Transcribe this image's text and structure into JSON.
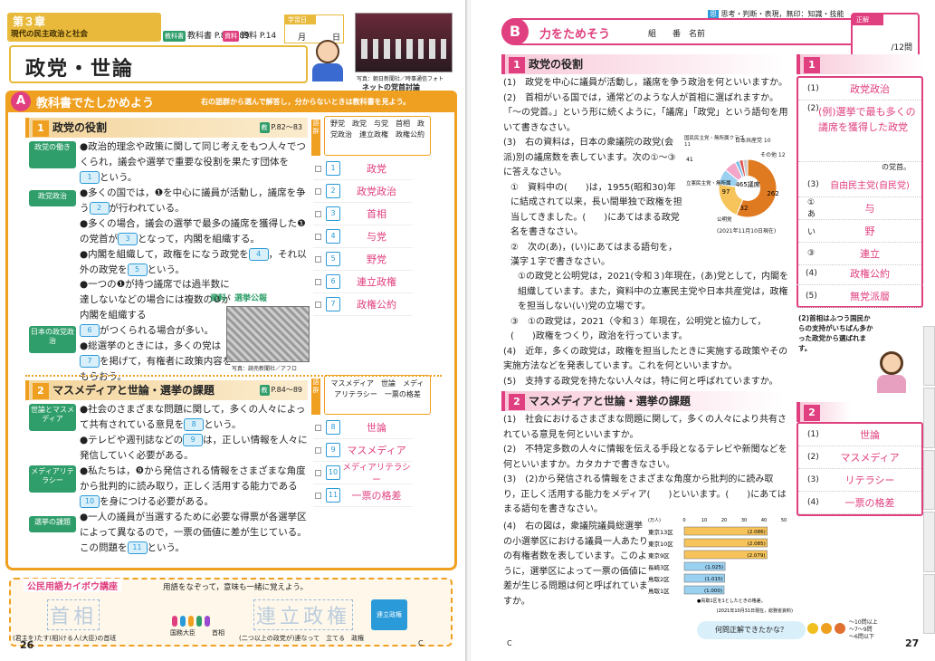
{
  "left": {
    "chapter": "第３章",
    "chapter_sub": "現代の民主政治と社会",
    "textbook_ref": "教科書 P.82〜89",
    "workbook_ref": "資料 P.14",
    "date_label": "学習日",
    "date_month": "月",
    "date_day": "日",
    "title": "政党・世論",
    "photo_caption": "写真：朝日新聞社／時事通信フォト",
    "photo_label": "ネットの党首討論",
    "sectionA_letter": "A",
    "sectionA_title": "教科書でたしかめよう",
    "sectionA_hint": "右の語群から選んで解答し，分からないときは教科書を見よう。",
    "s1_num": "1",
    "s1_title": "政党の役割",
    "s1_ref": "P.82〜83",
    "s1_words": "野党　政党　与党　首相　政党政治　連立政権　政権公約",
    "s1_side1": "政党の働き",
    "s1_side2": "政党政治",
    "s1_side3": "日本の政党政治",
    "s1_lines": [
      "●政治的理念や政策に関して同じ考えをもつ人々でつくられ，議会や選挙で重要な役割を果たす団体を",
      "という。",
      "●多くの国では，❶を中心に議員が活動し，議席を争う",
      "が行われている。",
      "●多くの場合，議会の選挙で最多の議席を獲得した❶の党首が",
      "となって，内閣を組織する。",
      "●内閣を組織して，政権をになう政党を",
      "，それ以外の政党を",
      "という。",
      "●一つの❶が持つ議席では過半数に達しないなどの場合には複数の❶が内閣を組織する",
      "資料　選挙公報",
      "がつくられる場合が多い。",
      "●総選挙のときには，多くの党は",
      "を掲げて，有権者に政策内容をもらおう。"
    ],
    "photo2_caption": "写真：読売新聞社／アフロ",
    "answers1": [
      "政党",
      "政党政治",
      "首相",
      "与党",
      "野党",
      "連立政権",
      "政権公約"
    ],
    "s2_num": "2",
    "s2_title": "マスメディアと世論・選挙の課題",
    "s2_ref": "P.84〜89",
    "s2_words": "マスメディア　世論　メディアリテラシー　一票の格差",
    "s2_side1": "世論とマスメディア",
    "s2_side2": "メディアリテラシー",
    "s2_side3": "選挙の課題",
    "s2_lines": [
      "●社会のさまざまな問題に関して，多くの人々によって共有されている意見を",
      "という。",
      "●テレビや週刊誌などの",
      "は，正しい情報を人々に発信していく必要がある。",
      "●私たちは，❾から発信される情報をさまざまな角度から批判的に読み取り，正しく活用する能力である",
      "を身につける必要がある。",
      "●一人の議員が当選するために必要な得票が各選挙区によって異なるので，一票の価値に差が生じている。この問題を",
      "という。"
    ],
    "answers2": [
      "世論",
      "マスメディア",
      "メディアリテラシー",
      "一票の格差"
    ],
    "footer_title": "公民用語カイボウ講座",
    "footer_hint": "用語をなぞって，意味も一緒に覚えよう。",
    "footer_w1": "首相",
    "footer_w1_desc": "(君主を)たす(相)ける人(大臣)の首班",
    "footer_w2": "連立政権",
    "footer_w2_desc": "(二つ以上の政党が)連なって　立てる　政権",
    "footer_cabinet": "国務大臣",
    "footer_pm": "首相",
    "footer_coalition": "連立政権",
    "page_num": "26",
    "footer_mark": "C"
  },
  "right": {
    "legend": "思考・判断・表現，無印：知識・技能",
    "sectionB_letter": "B",
    "sectionB_title": "力をためそう",
    "class_label": "組　　番　名前",
    "score_label": "正解",
    "score_total": "/12問",
    "s1_num": "1",
    "s1_title": "政党の役割",
    "questions1": [
      "(1)　政党を中心に議員が活動し，議席を争う政治を何といいますか。",
      "(2)　首相がいる国では，通常どのような人が首相に選ばれますか。「〜の党首。」という形に続くように，「議席」「政党」という語句を用いて書きなさい。",
      "(3)　右の資料は，日本の衆議院の政党(会派)別の議席数を表しています。次の①〜③に答えなさい。",
      "①　資料中の(　　)は，1955(昭和30)年に結成されて以来，長い間単独で政権を担当してきました。(　　)にあてはまる政党名を書きなさい。",
      "②　次の(あ)，(い)にあてはまる語句を，漢字１字で書きなさい。",
      "①の政党と公明党は，2021(令和３)年現在，(あ)党として，内閣を組織しています。また，資料中の立憲民主党や日本共産党は，政権を担当しない(い)党の立場です。",
      "③　①の政党は，2021（令和３）年現在，公明党と協力して，(　　)政権をつくり，政治を行っています。",
      "(4)　近年，多くの政党は，政権を担当したときに実施する政策やその実施方法などを発表しています。これを何といいますか。",
      "(5)　支持する政党を持たない人々は，特に何と呼ばれていますか。"
    ],
    "pie_labels": [
      "国民民主党・無所属クラブ 11",
      "日本共産党 10",
      "その他 12",
      "立憲民主党・無所属",
      "公明党",
      "41",
      "97",
      "32",
      "465議席",
      "262"
    ],
    "pie_caption": "(2021年11月10日現在)",
    "pie_values": [
      262,
      97,
      41,
      32,
      11,
      10,
      12
    ],
    "answersR1": [
      "政党政治",
      "(例)選挙で最も多くの議席を獲得した政党",
      "の党首。",
      "自由民主党(自民党)",
      "与",
      "野",
      "連立",
      "政権公約",
      "無党派層"
    ],
    "ans_sub_labels": [
      "(1)",
      "(2)",
      "(3)",
      "①あ",
      "い",
      "③",
      "(4)",
      "(5)"
    ],
    "tip_text": "(2)首相はふつう国民からの支持がいちばん多かった政党から選ばれます。",
    "s2_num": "2",
    "s2_title": "マスメディアと世論・選挙の課題",
    "questions2": [
      "(1)　社会におけるさまざまな問題に関して，多くの人々により共有されている意見を何といいますか。",
      "(2)　不特定多数の人々に情報を伝える手段となるテレビや新聞などを何といいますか。カタカナで書きなさい。",
      "(3)　(2)から発信される情報をさまざまな角度から批判的に読み取り，正しく活用する能力をメディア(　　)といいます。(　　)にあてはまる語句を書きなさい。",
      "(4)　右の図は，衆議院議員総選挙の小選挙区における議員一人あたりの有権者数を表しています。このように，選挙区によって一票の価値に差が生じる問題は何と呼ばれていますか。"
    ],
    "answersR2": [
      "世論",
      "マスメディア",
      "リテラシー",
      "一票の格差"
    ],
    "bar_chart": {
      "unit": "(万人)",
      "ticks": [
        "0",
        "10",
        "20",
        "30",
        "40",
        "50"
      ],
      "categories": [
        "東京13区",
        "東京10区",
        "東京9区",
        "長崎3区",
        "鳥取2区",
        "鳥取1区"
      ],
      "values": [
        2.086,
        2.085,
        2.079,
        1.025,
        1.015,
        1.0
      ],
      "labels": [
        "(2.086)",
        "(2.085)",
        "(2.079)",
        "(1.025)",
        "(1.015)",
        "(1.000)"
      ],
      "note": "●鳥取1区を1としたときの格差。",
      "source": "(2021年10月31日現在，総務省資料)"
    },
    "check_text": "何問正解できたかな？",
    "grade_labels": [
      "〜10問以上",
      "〜7〜9問",
      "〜6問以下"
    ],
    "page_num": "27",
    "footer_mark": "C"
  }
}
